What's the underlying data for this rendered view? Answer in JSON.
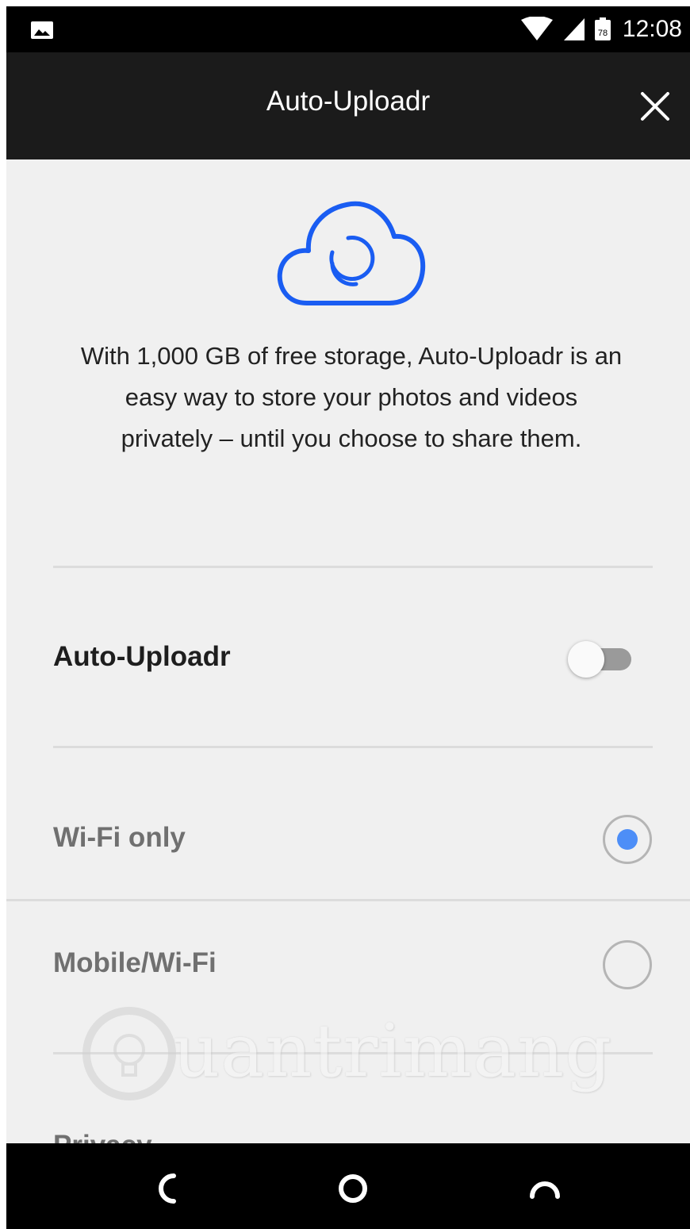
{
  "status_bar": {
    "time": "12:08",
    "left_icon": "image-notification-icon",
    "icons": [
      "wifi-icon",
      "cell-signal-icon",
      "calendar-icon"
    ],
    "calendar_day": "78"
  },
  "app_bar": {
    "title": "Auto-Uploadr",
    "close_icon": "close-icon"
  },
  "intro": {
    "icon": "cloud-sync-icon",
    "text": "With 1,000 GB of free storage, Auto-Uploadr is an easy way to store your photos and videos privately – until you choose to share them.",
    "accent_color": "#1a5df2"
  },
  "settings": {
    "auto_uploadr": {
      "label": "Auto-Uploadr",
      "enabled": false
    },
    "network_options": [
      {
        "label": "Wi-Fi only",
        "selected": true
      },
      {
        "label": "Mobile/Wi-Fi",
        "selected": false
      }
    ],
    "privacy_label": "Privacy",
    "radio_selected_color": "#4d8ef7"
  },
  "watermark": {
    "text": "uantrimang",
    "icon": "lightbulb-icon"
  },
  "nav_bar": {
    "back_icon": "back-icon",
    "home_icon": "home-icon",
    "recents_icon": "recents-icon"
  }
}
